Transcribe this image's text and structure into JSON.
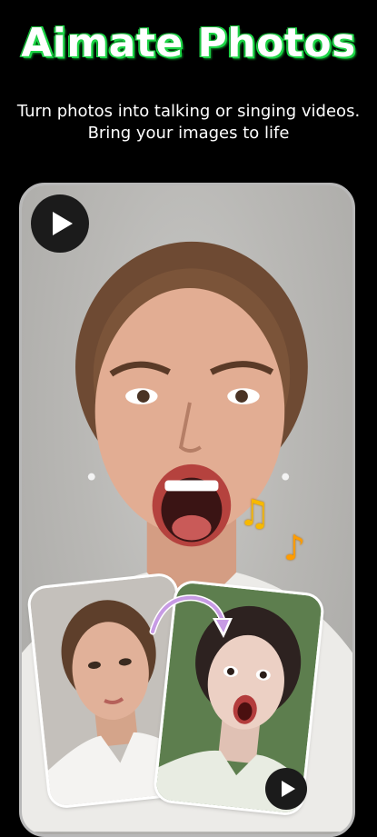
{
  "header": {
    "title": "Aimate Photos",
    "subtitle_line1": "Turn photos into talking or singing videos.",
    "subtitle_line2": "Bring your images to life"
  },
  "icons": {
    "main_play": "play-icon",
    "music_notes": "music-notes-icon",
    "transform_arrow": "curved-arrow-icon",
    "card_play": "play-icon"
  },
  "music_glyphs": {
    "note1": "♫",
    "note2": "♪"
  },
  "colors": {
    "title_glow": "#1fd94a",
    "background": "#000000",
    "music": "#f7b900"
  }
}
